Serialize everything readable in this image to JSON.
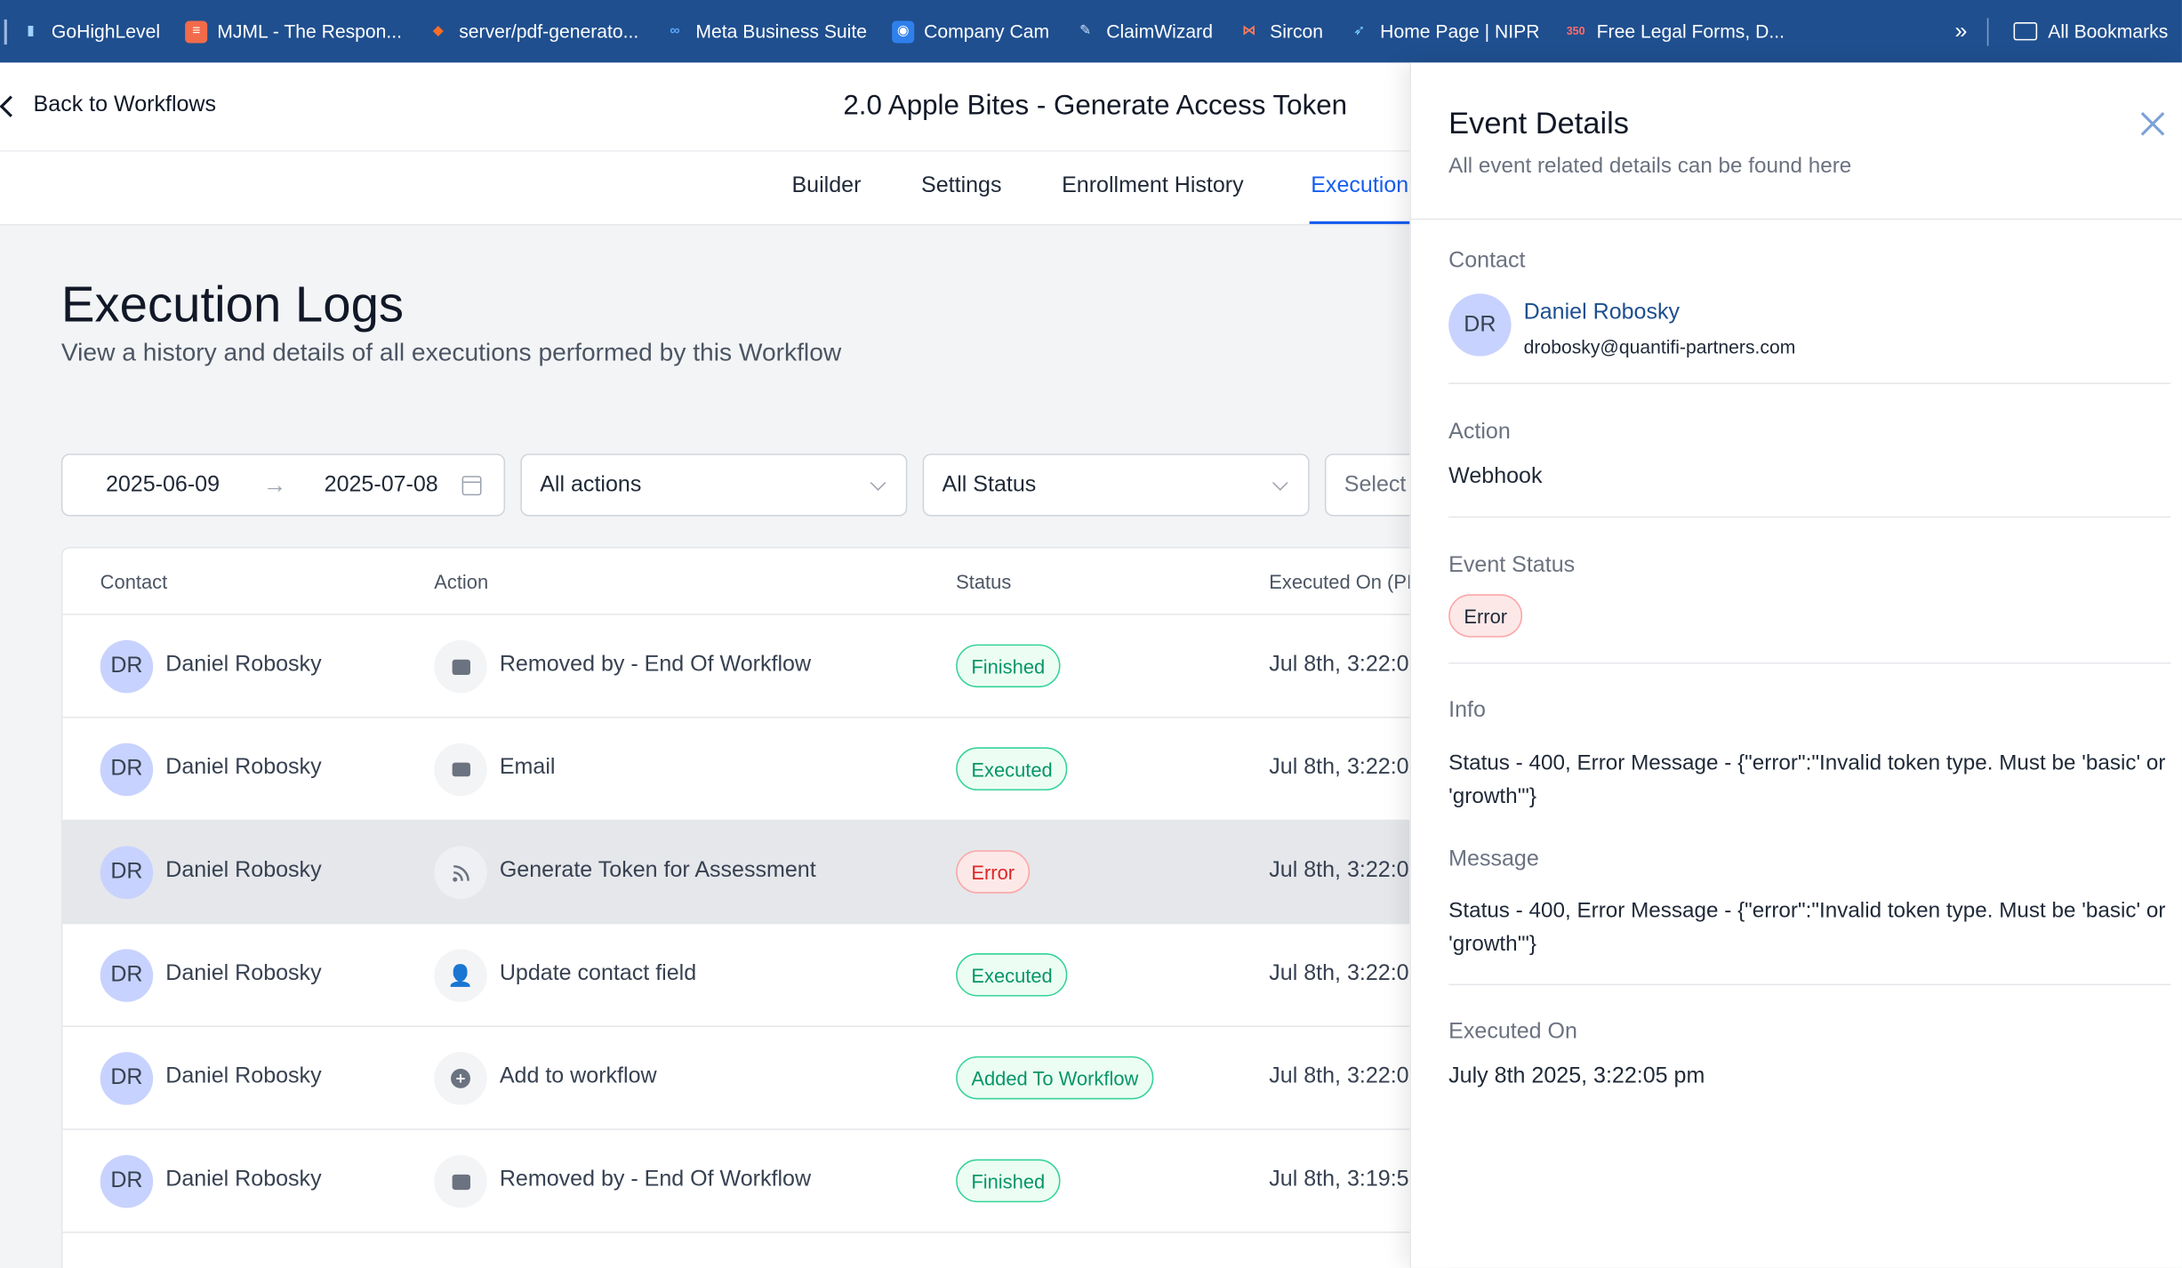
{
  "bookmarks": [
    {
      "label": "GoHighLevel",
      "icon": "gohighlevel-icon"
    },
    {
      "label": "MJML - The Respon...",
      "icon": "mjml-icon"
    },
    {
      "label": "server/pdf-generato...",
      "icon": "gitlab-icon"
    },
    {
      "label": "Meta Business Suite",
      "icon": "meta-icon"
    },
    {
      "label": "Company Cam",
      "icon": "camera-icon"
    },
    {
      "label": "ClaimWizard",
      "icon": "wizard-icon"
    },
    {
      "label": "Sircon",
      "icon": "sircon-icon"
    },
    {
      "label": "Home Page | NIPR",
      "icon": "nipr-icon"
    },
    {
      "label": "Free Legal Forms, D...",
      "icon": "legal-forms-icon"
    }
  ],
  "bookmarks_more": "»",
  "all_bookmarks": "All Bookmarks",
  "header": {
    "back_label": "Back to Workflows",
    "workflow_title": "2.0 Apple Bites - Generate Access Token"
  },
  "tabs": [
    "Builder",
    "Settings",
    "Enrollment History",
    "Execution"
  ],
  "active_tab": "Execution",
  "main": {
    "title": "Execution Logs",
    "subtitle": "View a history and details of all executions performed by this Workflow"
  },
  "filters": {
    "start_date": "2025-06-09",
    "arrow": "→",
    "end_date": "2025-07-08",
    "actions": "All actions",
    "status": "All Status",
    "more": "Select"
  },
  "table": {
    "columns": [
      "Contact",
      "Action",
      "Status",
      "Executed On (PI"
    ],
    "rows": [
      {
        "initials": "DR",
        "contact": "Daniel Robosky",
        "action": "Removed by - End Of Workflow",
        "action_icon": "remove-icon",
        "status": "Finished",
        "status_kind": "ok",
        "executed": "Jul 8th, 3:22:0"
      },
      {
        "initials": "DR",
        "contact": "Daniel Robosky",
        "action": "Email",
        "action_icon": "email-icon",
        "status": "Executed",
        "status_kind": "ok",
        "executed": "Jul 8th, 3:22:0"
      },
      {
        "initials": "DR",
        "contact": "Daniel Robosky",
        "action": "Generate Token for Assessment",
        "action_icon": "webhook-icon",
        "status": "Error",
        "status_kind": "err",
        "executed": "Jul 8th, 3:22:0"
      },
      {
        "initials": "DR",
        "contact": "Daniel Robosky",
        "action": "Update contact field",
        "action_icon": "contact-field-icon",
        "status": "Executed",
        "status_kind": "ok",
        "executed": "Jul 8th, 3:22:0"
      },
      {
        "initials": "DR",
        "contact": "Daniel Robosky",
        "action": "Add to workflow",
        "action_icon": "add-icon",
        "status": "Added To Workflow",
        "status_kind": "ok",
        "executed": "Jul 8th, 3:22:0"
      },
      {
        "initials": "DR",
        "contact": "Daniel Robosky",
        "action": "Removed by - End Of Workflow",
        "action_icon": "remove-icon",
        "status": "Finished",
        "status_kind": "ok",
        "executed": "Jul 8th, 3:19:5"
      }
    ]
  },
  "panel": {
    "title": "Event Details",
    "subtitle": "All event related details can be found here",
    "contact_label": "Contact",
    "contact_initials": "DR",
    "contact_name": "Daniel Robosky",
    "contact_email": "drobosky@quantifi-partners.com",
    "action_label": "Action",
    "action_value": "Webhook",
    "status_label": "Event Status",
    "status_value": "Error",
    "info_label": "Info",
    "info_value": "Status - 400, Error Message - {\"error\":\"Invalid token type. Must be 'basic' or 'growth'\"}",
    "message_label": "Message",
    "message_value": "Status - 400, Error Message - {\"error\":\"Invalid token type. Must be 'basic' or 'growth'\"}",
    "executed_label": "Executed On",
    "executed_value": "July 8th 2025, 3:22:05 pm"
  },
  "colors": {
    "bookmark_bar": "#1f4f8f",
    "accent": "#155eef",
    "success": "#059669",
    "error": "#dc2626"
  }
}
